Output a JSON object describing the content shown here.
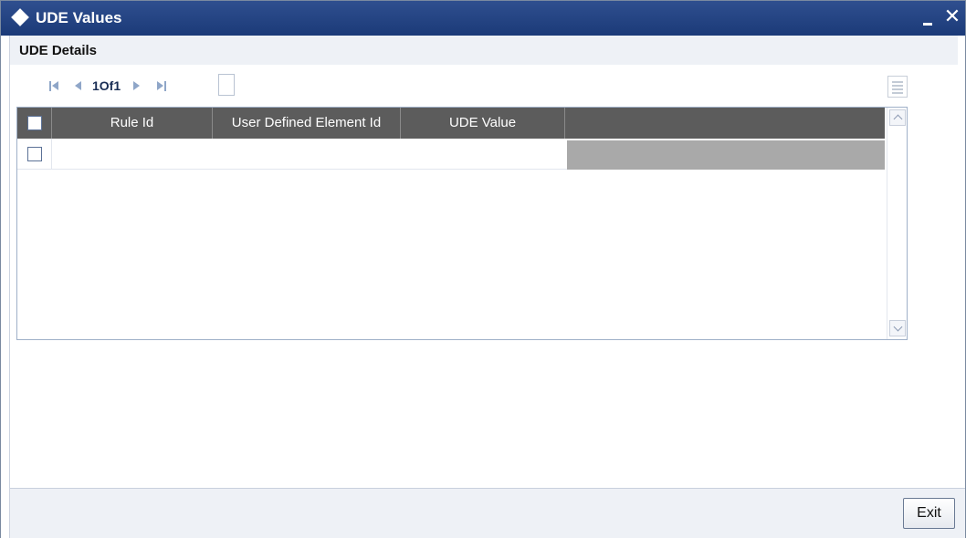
{
  "window": {
    "title": "UDE Values",
    "minimize_label": "_",
    "close_label": "✕"
  },
  "section": {
    "title": "UDE Details"
  },
  "pager": {
    "text": "1Of1",
    "current_value": ""
  },
  "grid": {
    "columns": [
      "Rule Id",
      "User Defined Element Id",
      "UDE Value",
      ""
    ],
    "rows": [
      {
        "rule_id": "",
        "ude_id": "",
        "ude_value": ""
      }
    ]
  },
  "footer": {
    "exit_label": "Exit"
  },
  "icons": {
    "title": "diamond-icon",
    "first": "first-page-icon",
    "prev": "prev-page-icon",
    "next": "next-page-icon",
    "last": "last-page-icon",
    "view": "grid-view-icon"
  },
  "colors": {
    "titlebar": "#1b3a78",
    "grid_header": "#5c5c5c",
    "row_highlight": "#a9a9a9"
  }
}
